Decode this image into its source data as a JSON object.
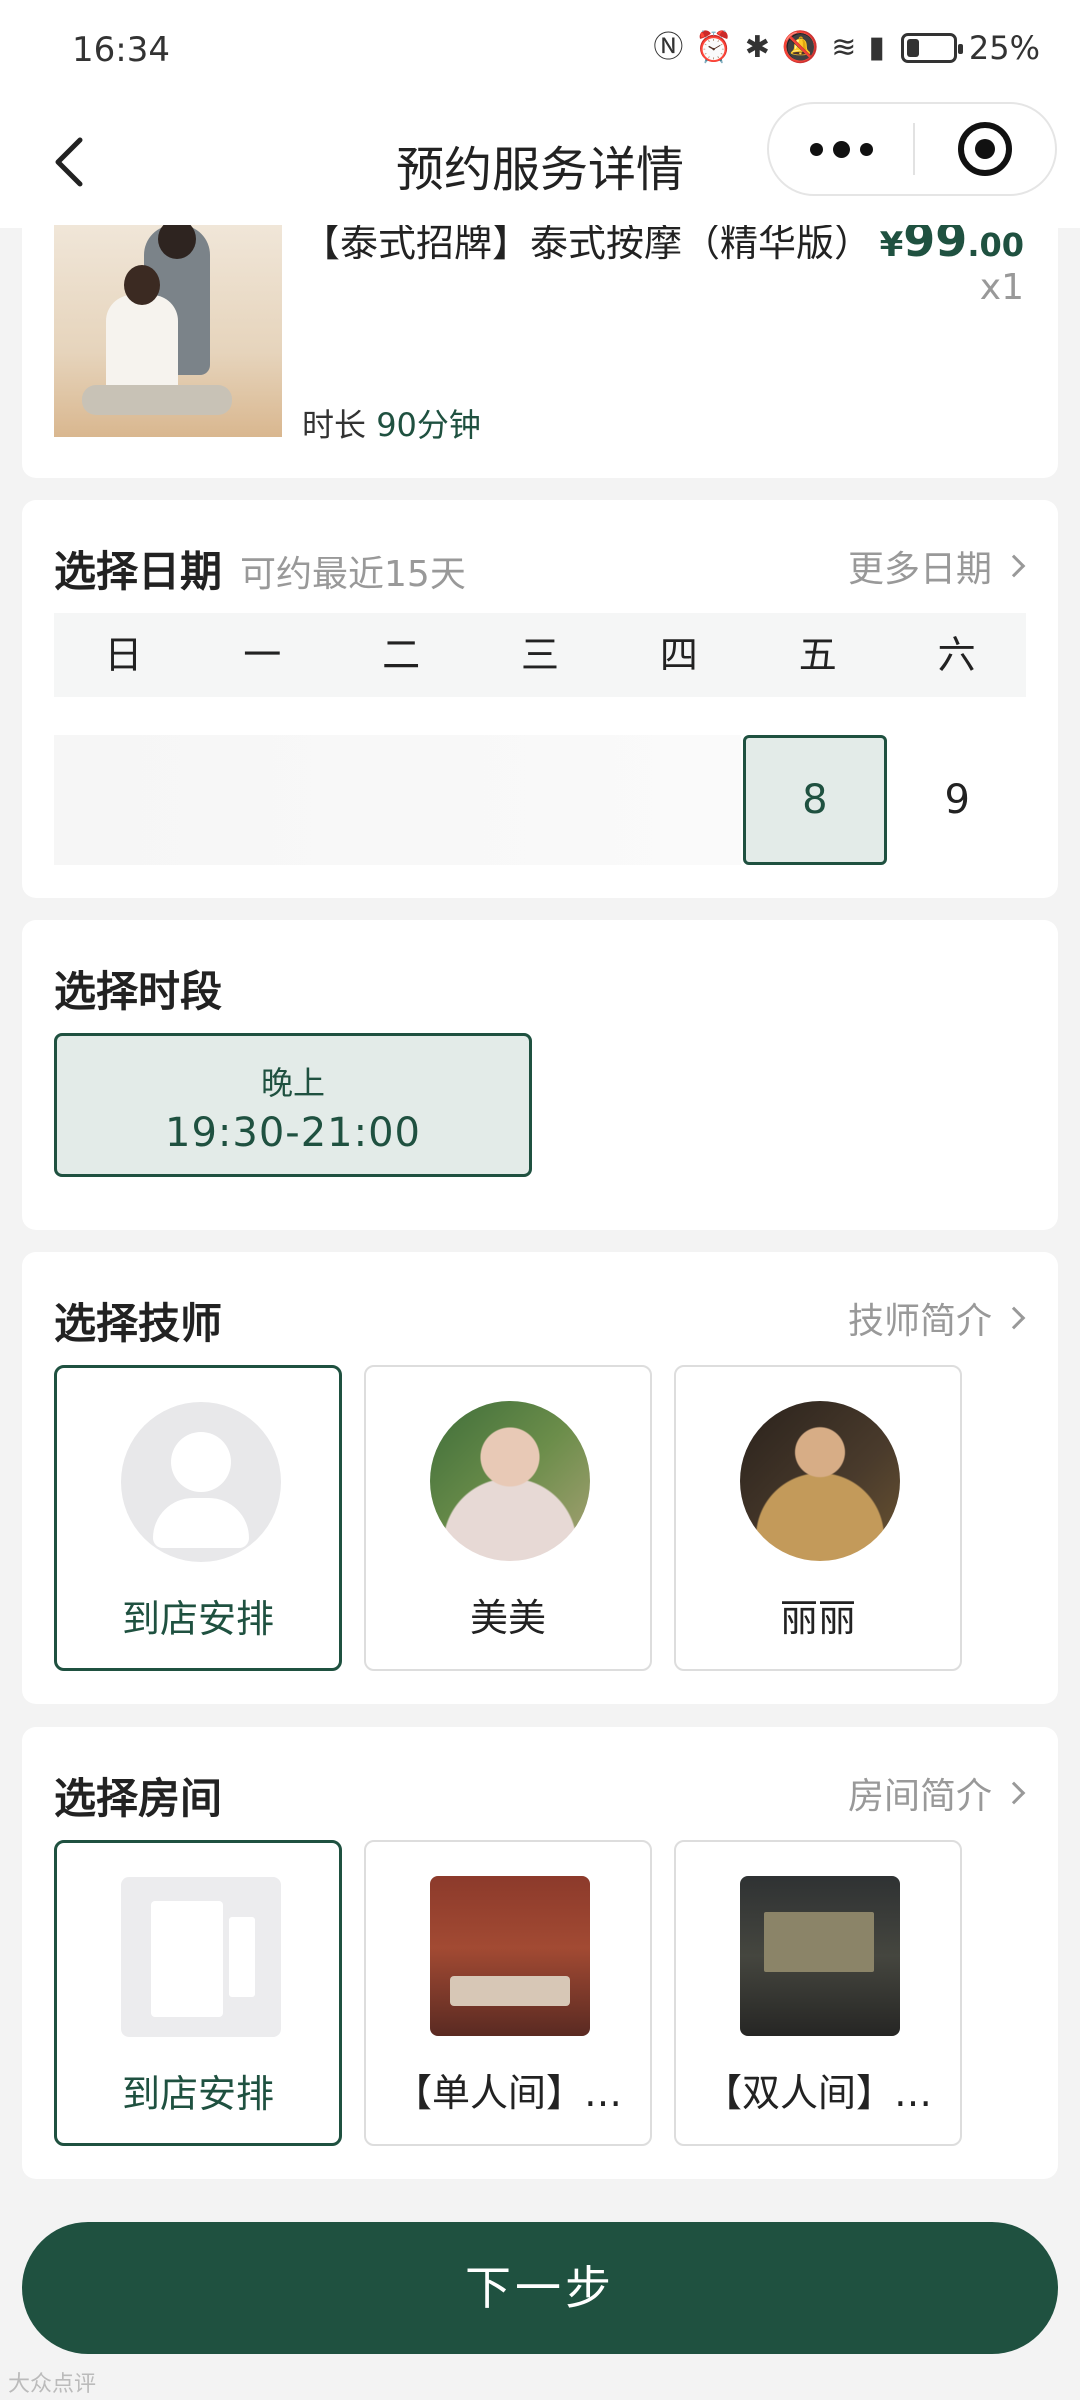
{
  "status_bar": {
    "time": "16:34",
    "battery": "25%"
  },
  "nav": {
    "title": "预约服务详情"
  },
  "product": {
    "name": "【泰式招牌】泰式按摩（精华版）",
    "price_symbol": "¥",
    "price_int": "99",
    "price_dec": ".00",
    "quantity": "x1",
    "duration_label": "时长",
    "duration_value": "90分钟"
  },
  "date_section": {
    "title": "选择日期",
    "subtitle": "可约最近15天",
    "more_link": "更多日期",
    "weekdays": [
      "日",
      "一",
      "二",
      "三",
      "四",
      "五",
      "六"
    ],
    "days": [
      "8",
      "9"
    ],
    "selected_day": "8"
  },
  "time_section": {
    "title": "选择时段",
    "slots": [
      {
        "label": "晚上",
        "time": "19:30-21:00",
        "selected": true
      }
    ]
  },
  "tech_section": {
    "title": "选择技师",
    "link": "技师简介",
    "options": [
      {
        "name": "到店安排",
        "selected": true
      },
      {
        "name": "美美",
        "selected": false
      },
      {
        "name": "丽丽",
        "selected": false
      }
    ]
  },
  "room_section": {
    "title": "选择房间",
    "link": "房间简介",
    "options": [
      {
        "name": "到店安排",
        "selected": true
      },
      {
        "name": "【单人间】…",
        "selected": false
      },
      {
        "name": "【双人间】…",
        "selected": false
      }
    ]
  },
  "next_button": "下一步",
  "watermark": "大众点评",
  "colors": {
    "accent": "#1f5140",
    "selected_bg": "#e3ebe8"
  }
}
